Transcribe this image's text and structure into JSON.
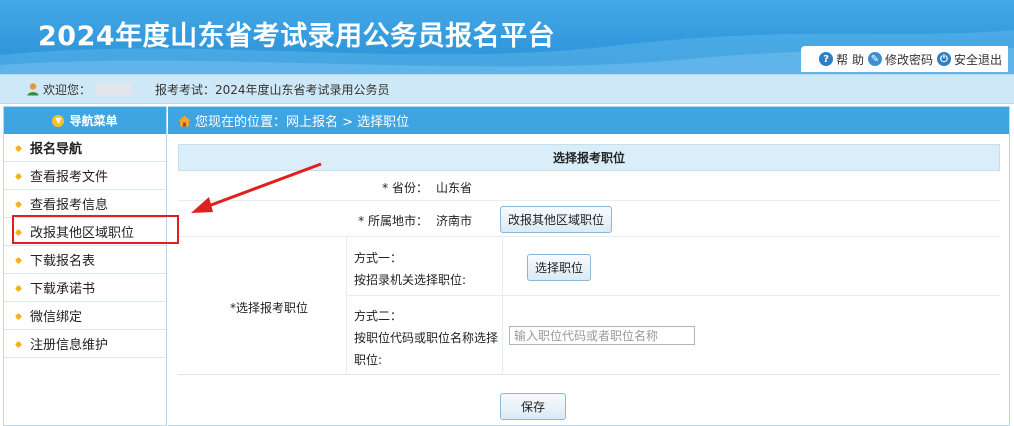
{
  "header": {
    "title": "2024年度山东省考试录用公务员报名平台",
    "tools": [
      {
        "label": "帮 助",
        "icon": "help-icon"
      },
      {
        "label": "修改密码",
        "icon": "password-icon"
      },
      {
        "label": "安全退出",
        "icon": "power-icon"
      }
    ]
  },
  "infobar": {
    "welcome": "欢迎您：",
    "exam": "报考考试：2024年度山东省考试录用公务员"
  },
  "sidebar": {
    "header": "导航菜单",
    "items": [
      {
        "label": "报名导航"
      },
      {
        "label": "查看报考文件"
      },
      {
        "label": "查看报考信息"
      },
      {
        "label": "改报其他区域职位"
      },
      {
        "label": "下载报名表"
      },
      {
        "label": "下载承诺书"
      },
      {
        "label": "微信绑定"
      },
      {
        "label": "注册信息维护"
      }
    ]
  },
  "breadcrumb": "您现在的位置：网上报名 > 选择职位",
  "form": {
    "title": "选择报考职位",
    "province_label": "* 省份：",
    "province_value": "山东省",
    "city_label": "* 所属地市：",
    "city_value": "济南市",
    "change_button": "改报其他区域职位",
    "position_label": "*选择报考职位",
    "method1_title": "方式一：",
    "method1_desc": "按招录机关选择职位:",
    "select_button": "选择职位",
    "method2_title": "方式二：",
    "method2_desc_1": "按职位代码或职位名称选择",
    "method2_desc_2": "职位:",
    "search_placeholder": "输入职位代码或者职位名称",
    "save_button": "保存"
  },
  "colors": {
    "header_blue": "#3399dd",
    "nav_blue": "#3fa4e2",
    "highlight_red": "#e02020"
  }
}
